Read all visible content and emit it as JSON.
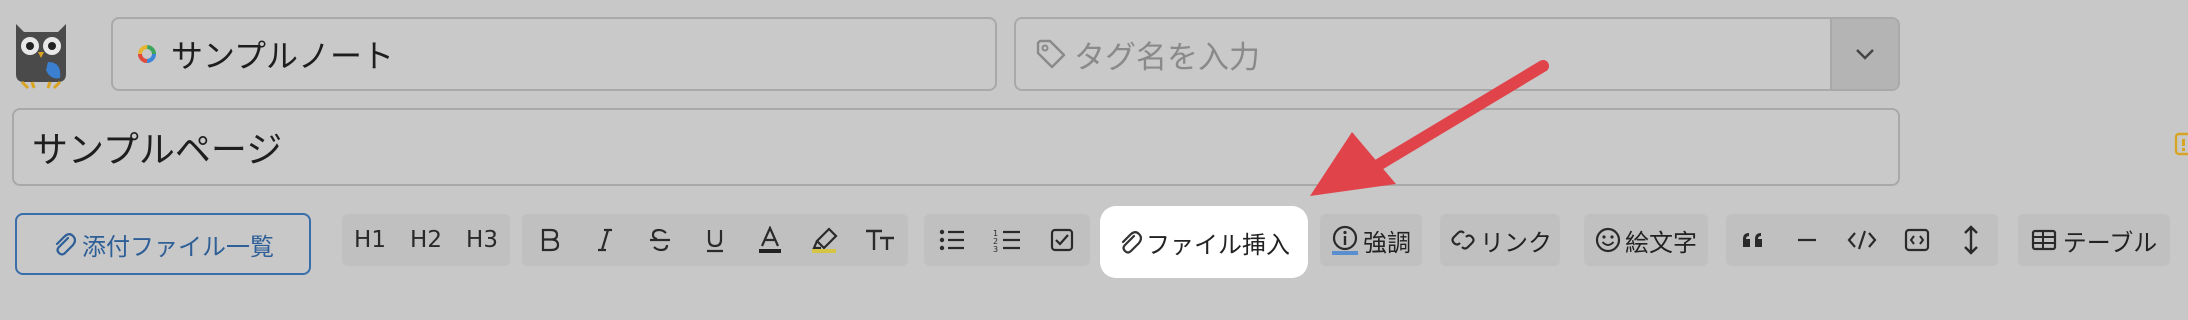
{
  "header": {
    "notebook_name": "サンプルノート",
    "tag_placeholder": "タグ名を入力"
  },
  "page": {
    "title": "サンプルページ"
  },
  "toolbar": {
    "attachments_label": "添付ファイル一覧",
    "h1": "H1",
    "h2": "H2",
    "h3": "H3",
    "file_insert_label": "ファイル挿入",
    "emphasis_label": "強調",
    "link_label": "リンク",
    "emoji_label": "絵文字",
    "table_label": "テーブル"
  },
  "colors": {
    "background": "#c8c8c8",
    "accent_blue": "#2e5f97",
    "arrow_red": "#e0444a",
    "highlight_white": "#ffffff"
  },
  "icons": [
    "owl-logo-icon",
    "notebook-ring-icon",
    "tag-icon",
    "chevron-down-icon",
    "paperclip-icon",
    "bold-icon",
    "italic-icon",
    "strikethrough-icon",
    "underline-icon",
    "text-color-icon",
    "highlighter-icon",
    "font-size-icon",
    "bullet-list-icon",
    "numbered-list-icon",
    "checklist-icon",
    "info-icon",
    "link-icon",
    "emoji-icon",
    "quote-icon",
    "horizontal-rule-icon",
    "code-icon",
    "code-block-icon",
    "line-height-icon",
    "table-icon"
  ]
}
